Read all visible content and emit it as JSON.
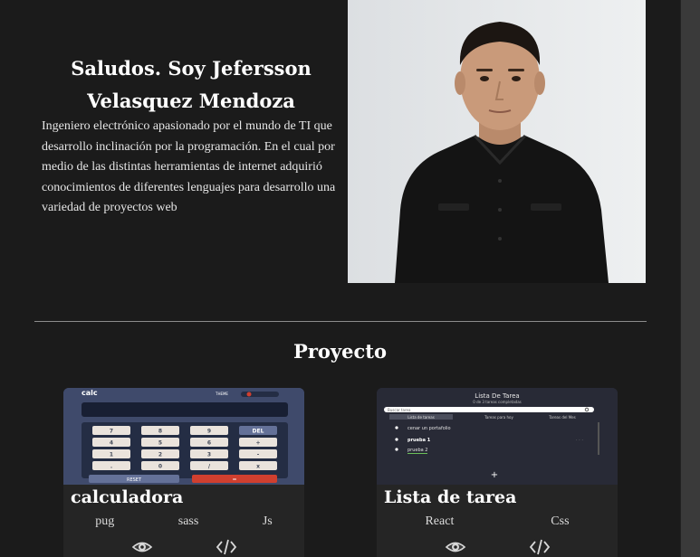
{
  "hero": {
    "title": "Saludos. Soy Jefersson Velasquez Mendoza",
    "description": "Ingeniero electrónico apasionado por el mundo de TI que desarrollo inclinación por la programación. En el cual por medio de las distintas herramientas de internet adquirió conocimientos de diferentes lenguajes para desarrollo una variedad de proyectos web"
  },
  "projects_section": {
    "title": "Proyecto",
    "projects": [
      {
        "title": "calculadora",
        "techs": [
          "pug",
          "sass",
          "Js"
        ],
        "thumbnail": {
          "app_label": "calc",
          "theme_label": "THEME",
          "keys": [
            "7",
            "8",
            "9",
            "DEL",
            "4",
            "5",
            "6",
            "+",
            "1",
            "2",
            "3",
            "-",
            ".",
            "0",
            "/",
            "x"
          ],
          "reset_label": "RESET",
          "equals_label": "="
        },
        "actions": [
          "eye-icon",
          "code-icon"
        ]
      },
      {
        "title": "Lista de tarea",
        "techs": [
          "React",
          "Css"
        ],
        "thumbnail": {
          "app_label": "Lista De Tarea",
          "subtitle": "0 de 3 tareas completadas",
          "search_placeholder": "Buscar tarea",
          "tabs": [
            "Lista de tareas",
            "Tareas para hoy",
            "Tareas del Mes"
          ],
          "items": [
            "cenar un portafolio",
            "prueba 1",
            "prueba 2"
          ],
          "add_label": "+"
        },
        "actions": [
          "eye-icon",
          "code-icon"
        ]
      }
    ]
  },
  "colors": {
    "background": "#1b1b1b",
    "card": "#252525",
    "calc_bg": "#3f4a6b",
    "calc_accent": "#d03f2f",
    "todo_bg": "#282a36"
  }
}
